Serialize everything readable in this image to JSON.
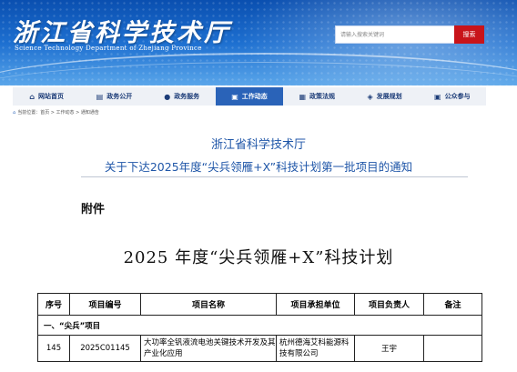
{
  "site": {
    "name": "浙江省科学技术厅",
    "name_en": "Science Technology Department of Zhejiang Province"
  },
  "search": {
    "placeholder": "请输入搜索关键词",
    "button": "搜索"
  },
  "nav": [
    {
      "label": "网站首页",
      "icon": "home-icon",
      "active": false
    },
    {
      "label": "政务公开",
      "icon": "book-icon",
      "active": false
    },
    {
      "label": "政务服务",
      "icon": "chat-icon",
      "active": false
    },
    {
      "label": "工作动态",
      "icon": "monitor-icon",
      "active": true
    },
    {
      "label": "政策法规",
      "icon": "document-icon",
      "active": false
    },
    {
      "label": "发展规划",
      "icon": "chart-icon",
      "active": false
    },
    {
      "label": "公众参与",
      "icon": "people-icon",
      "active": false
    }
  ],
  "breadcrumb": "当前位置：首页 > 工作动态 > 通知通告",
  "article": {
    "org": "浙江省科学技术厅",
    "title": "关于下达2025年度“尖兵领雁+X”科技计划第一批项目的通知",
    "attachment": "附件",
    "doc_title": "2025 年度“尖兵领雁+X”科技计划"
  },
  "table": {
    "headers": [
      "序号",
      "项目编号",
      "项目名称",
      "项目承担单位",
      "项目负责人",
      "备注"
    ],
    "section": "一、“尖兵”项目",
    "rows": [
      {
        "no": "145",
        "code": "2025C01145",
        "name": "大功率全钒液流电池关键技术开发及其产业化应用",
        "unit": "杭州德海艾科能源科技有限公司",
        "leader": "王宇",
        "note": ""
      }
    ]
  },
  "colors": {
    "banner": "#1d6fd0",
    "nav_active": "#2a63b8",
    "search_button": "#c8141a",
    "title_text": "#1f56a8"
  }
}
